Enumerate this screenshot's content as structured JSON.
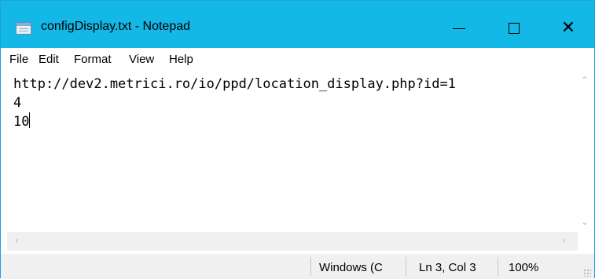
{
  "window": {
    "title": "configDisplay.txt - Notepad",
    "accent": "#13b8e6",
    "controls": {
      "minimize": "—",
      "maximize": "☐",
      "close": "✕"
    }
  },
  "menu": [
    "File",
    "Edit",
    "Format",
    "View",
    "Help"
  ],
  "editor": {
    "lines": [
      "http://dev2.metrici.ro/io/ppd/location_display.php?id=1",
      "4",
      "10"
    ]
  },
  "scrollbars": {
    "up_icon": "chevron-up-icon",
    "down_icon": "chevron-down-icon",
    "left_icon": "chevron-left-icon",
    "right_icon": "chevron-right-icon"
  },
  "statusbar": {
    "encoding": "Windows (C",
    "position": "Ln 3, Col 3",
    "zoom": "100%"
  }
}
